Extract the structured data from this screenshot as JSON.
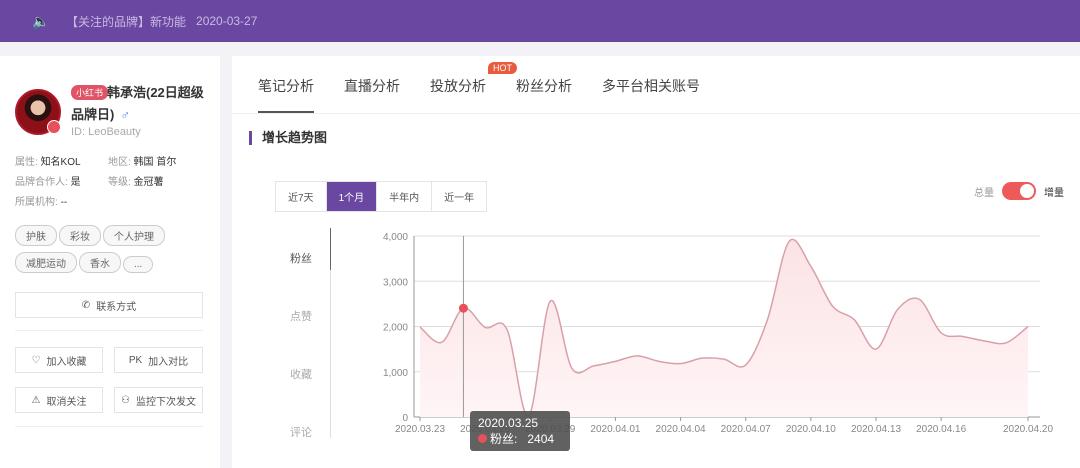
{
  "announcement": {
    "icon": "speaker-icon",
    "message": "【关注的品牌】新功能",
    "date": "2020-03-27"
  },
  "profile": {
    "platform_badge": "小红书",
    "name_line1": "韩承浩(22日超级",
    "name_line2": "品牌日)",
    "gender": "♂",
    "id": "ID:  LeoBeauty",
    "attrs": [
      {
        "label": "属性:",
        "value": "知名KOL"
      },
      {
        "label": "地区:",
        "value": "韩国 首尔"
      },
      {
        "label": "品牌合作人:",
        "value": "是"
      },
      {
        "label": "等级:",
        "value": "金冠薯"
      },
      {
        "label": "所属机构:",
        "value": "--"
      }
    ],
    "tags": [
      "护肤",
      "彩妆",
      "个人护理",
      "减肥运动",
      "香水",
      "..."
    ]
  },
  "actions": {
    "contact": "联系方式",
    "favorite": "加入收藏",
    "compare_prefix": "PK",
    "compare": "加入对比",
    "unfollow": "取消关注",
    "monitor": "监控下次发文"
  },
  "tabs": [
    {
      "label": "笔记分析",
      "active": true
    },
    {
      "label": "直播分析"
    },
    {
      "label": "投放分析"
    },
    {
      "label": "粉丝分析"
    },
    {
      "label": "多平台相关账号"
    }
  ],
  "hot_badge": "HOT",
  "section_title": "增长趋势图",
  "ranges": [
    {
      "label": "近7天"
    },
    {
      "label": "1个月",
      "active": true
    },
    {
      "label": "半年内"
    },
    {
      "label": "近一年"
    }
  ],
  "toggle": {
    "left": "总量",
    "right": "增量",
    "on": true
  },
  "metrics": [
    {
      "label": "粉丝",
      "active": true
    },
    {
      "label": "点赞"
    },
    {
      "label": "收藏"
    },
    {
      "label": "评论"
    }
  ],
  "tooltip": {
    "date": "2020.03.25",
    "series": "粉丝:",
    "value": "2404"
  },
  "colors": {
    "brand": "#6a47a0",
    "line": "#d9a0a8",
    "fill": "#fbe3e5",
    "marker": "#e8505b"
  },
  "chart_data": {
    "type": "area",
    "series_name": "粉丝",
    "x": [
      "2020.03.23",
      "2020.03.24",
      "2020.03.25",
      "2020.03.26",
      "2020.03.27",
      "2020.03.28",
      "2020.03.29",
      "2020.03.30",
      "2020.03.31",
      "2020.04.01",
      "2020.04.02",
      "2020.04.03",
      "2020.04.04",
      "2020.04.05",
      "2020.04.06",
      "2020.04.07",
      "2020.04.08",
      "2020.04.09",
      "2020.04.10",
      "2020.04.11",
      "2020.04.12",
      "2020.04.13",
      "2020.04.14",
      "2020.04.15",
      "2020.04.16",
      "2020.04.17",
      "2020.04.18",
      "2020.04.19",
      "2020.04.20"
    ],
    "values": [
      1990,
      1650,
      2404,
      1980,
      1940,
      20,
      2560,
      1070,
      1130,
      1230,
      1350,
      1230,
      1180,
      1300,
      1280,
      1150,
      2150,
      3880,
      3330,
      2450,
      2150,
      1500,
      2380,
      2600,
      1860,
      1780,
      1680,
      1640,
      2000
    ],
    "xticks": [
      "2020.03.23",
      "2020.03.26",
      "2020.03.29",
      "2020.04.01",
      "2020.04.04",
      "2020.04.07",
      "2020.04.10",
      "2020.04.13",
      "2020.04.16",
      "2020.04.20"
    ],
    "yticks": [
      "0",
      "1,000",
      "2,000",
      "3,000",
      "4,000"
    ],
    "ylim": [
      0,
      4000
    ],
    "grid": true,
    "highlight_index": 2
  }
}
